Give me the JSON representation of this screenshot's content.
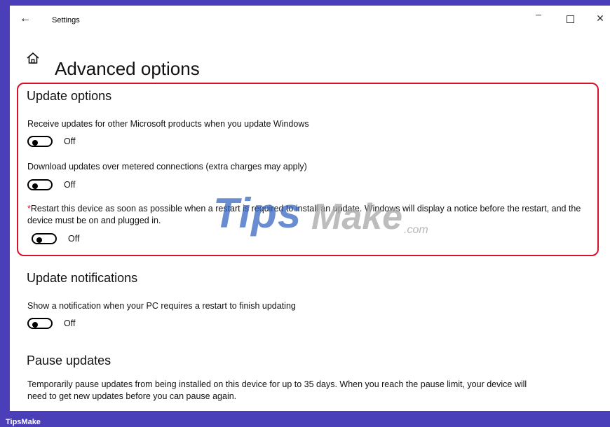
{
  "window": {
    "title": "Settings",
    "back_icon": "back-arrow-icon",
    "minimize": "–",
    "close": "✕"
  },
  "page": {
    "title": "Advanced options",
    "icon": "home-icon"
  },
  "update_options": {
    "heading": "Update options",
    "items": [
      {
        "label": "Receive updates for other Microsoft products when you update Windows",
        "state": "Off"
      },
      {
        "label": "Download updates over metered connections (extra charges may apply)",
        "state": "Off"
      },
      {
        "asterisk": "*",
        "label": "Restart this device as soon as possible when a restart is required to install an update. Windows will display a notice before the restart, and the device must be on and plugged in.",
        "state": "Off"
      }
    ],
    "highlight_color": "#d8112a"
  },
  "update_notifications": {
    "heading": "Update notifications",
    "label": "Show a notification when your PC requires a restart to finish updating",
    "state": "Off"
  },
  "pause_updates": {
    "heading": "Pause updates",
    "label": "Temporarily pause updates from being installed on this device for up to 35 days. When you reach the pause limit, your device will need to get new updates before you can pause again."
  },
  "watermark": {
    "tips": "Tips",
    "make": "Make",
    "com": ".com"
  },
  "footer": {
    "label": "TipsMake",
    "color": "#4a3fb8"
  }
}
